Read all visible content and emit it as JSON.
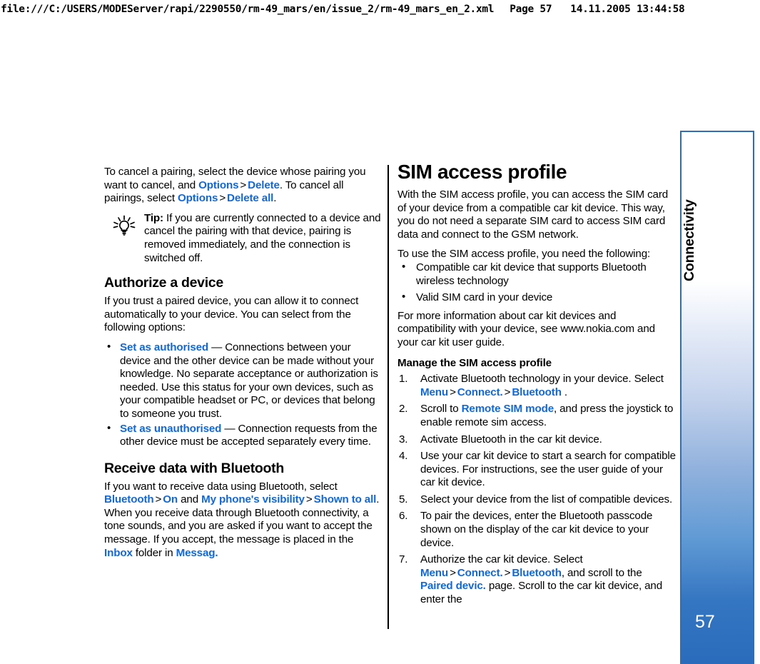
{
  "print_header": {
    "url": "file:///C:/USERS/MODEServer/rapi/2290550/rm-49_mars/en/issue_2/rm-49_mars_en_2.xml",
    "page_label": "Page 57",
    "timestamp": "14.11.2005 13:44:58"
  },
  "colors": {
    "link": "#1168d9",
    "tab_blue": "#2a6cbb",
    "tab_border": "#2f6db5"
  },
  "sidebar": {
    "chapter_label": "Connectivity",
    "page_number": "57"
  },
  "left_column": {
    "para_cancel": {
      "t1": "To cancel a pairing, select the device whose pairing you want to cancel, and ",
      "l1": "Options",
      "gt1": ">",
      "l2": "Delete",
      "t2": ". To cancel all pairings, select ",
      "l3": "Options",
      "gt2": ">",
      "l4": "Delete all",
      "t3": "."
    },
    "tip": {
      "icon": "lightbulb-icon",
      "label": "Tip:",
      "text": " If you are currently connected to a device and cancel the pairing with that device, pairing is removed immediately, and the connection is switched off."
    },
    "authorize": {
      "heading": "Authorize a device",
      "intro": "If you trust a paired device, you can allow it to connect automatically to your device. You can select from the following options:",
      "bullets": [
        {
          "link": "Set as authorised",
          "text": " — Connections between your device and the other device can be made without your knowledge. No separate acceptance or authorization is needed. Use this status for your own devices, such as your compatible headset or PC, or devices that belong to someone you trust."
        },
        {
          "link": "Set as unauthorised",
          "text": " — Connection requests from the other device must be accepted separately every time."
        }
      ]
    },
    "receive": {
      "heading": "Receive data with Bluetooth",
      "t1": "If you want to receive data using Bluetooth, select ",
      "l1": "Bluetooth",
      "gt1": ">",
      "l2": "On",
      "t2": " and ",
      "l3": "My phone's visibility",
      "gt2": ">",
      "l4": "Shown to all",
      "t3": ". When you receive data through Bluetooth connectivity, a tone sounds, and you are asked if you want to accept the message. If you accept, the message is placed in the ",
      "l5": "Inbox",
      "t4": " folder in ",
      "l6": "Messag.",
      "t5": ""
    }
  },
  "right_column": {
    "heading": "SIM access profile",
    "intro": "With the SIM access profile, you can access the SIM card of your device from a compatible car kit device. This way, you do not need a separate SIM card to access SIM card data and connect to the GSM network.",
    "requirements_intro": "To use the SIM access profile, you need the following:",
    "requirements": [
      "Compatible car kit device that supports Bluetooth wireless technology",
      "Valid SIM card in your device"
    ],
    "more_info": "For more information about car kit devices and compatibility with your device, see www.nokia.com and your car kit user guide.",
    "manage_heading": "Manage the SIM access profile",
    "steps": [
      {
        "t1": "Activate Bluetooth technology in your device. Select ",
        "l1": "Menu",
        "gt1": ">",
        "l2": "Connect.",
        "gt2": ">",
        "l3": "Bluetooth",
        "t2": " ."
      },
      {
        "t1": "Scroll to ",
        "l1": "Remote SIM mode",
        "t2": ", and press the joystick to enable remote sim access."
      },
      {
        "t1": "Activate Bluetooth in the car kit device."
      },
      {
        "t1": "Use your car kit device to start a search for compatible devices. For instructions, see the user guide of your car kit device."
      },
      {
        "t1": "Select your device from the list of compatible devices."
      },
      {
        "t1": "To pair the devices, enter the Bluetooth passcode shown on the display of the car kit device to your device."
      },
      {
        "t1": "Authorize the car kit device. Select ",
        "l1": "Menu",
        "gt1": ">",
        "l2": "Connect.",
        "gt2": ">",
        "l3": "Bluetooth",
        "t2": ", and scroll to the ",
        "l4": "Paired devic.",
        "t3": " page. Scroll to the car kit device, and enter the"
      }
    ]
  }
}
